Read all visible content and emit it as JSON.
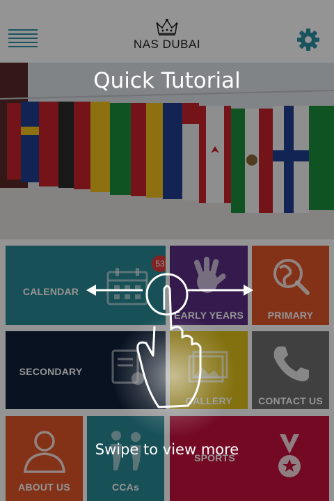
{
  "header": {
    "logo_text": "NAS DUBAI",
    "menu_icon": "hamburger-icon",
    "settings_icon": "gear-icon",
    "accent": "#2b8fa3"
  },
  "tutorial": {
    "title": "Quick Tutorial",
    "hint": "Swipe to view more"
  },
  "tiles": {
    "calendar": {
      "label": "CALENDAR",
      "badge": "53",
      "color": "#2a8a96"
    },
    "early_years": {
      "label": "EARLY YEARS",
      "color": "#5a2d86"
    },
    "primary": {
      "label": "PRIMARY",
      "color": "#e2562a"
    },
    "secondary": {
      "label": "SECONDARY",
      "color": "#0e1f3a"
    },
    "gallery": {
      "label": "GALLERY",
      "color": "#e2c21a"
    },
    "contact_us": {
      "label": "CONTACT US",
      "color": "#6f6f6f"
    },
    "about_us": {
      "label": "ABOUT US",
      "color": "#e2562a"
    },
    "ccas": {
      "label": "CCAs",
      "color": "#2a8a96"
    },
    "sports": {
      "label": "SPORTS",
      "color": "#c8103e"
    }
  }
}
